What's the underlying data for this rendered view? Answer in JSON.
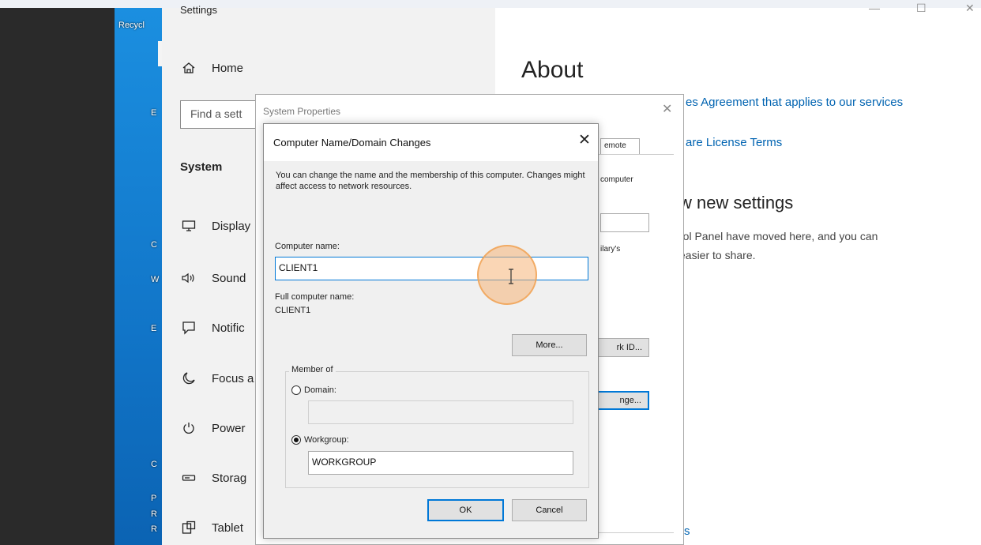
{
  "desktop": {
    "recycle_label": "Recycl",
    "letters": [
      "E",
      "C",
      "W",
      "E",
      "C",
      "P",
      "R",
      "R"
    ]
  },
  "settings": {
    "title": "Settings",
    "window_controls": [
      "—",
      "☐",
      "✕"
    ],
    "home_label": "Home",
    "search_placeholder": "Find a sett",
    "section_heading": "System",
    "nav_items": [
      {
        "label": "Display",
        "icon": "monitor-icon"
      },
      {
        "label": "Sound",
        "icon": "speaker-icon"
      },
      {
        "label": "Notific",
        "icon": "notification-icon"
      },
      {
        "label": "Focus a",
        "icon": "moon-icon"
      },
      {
        "label": "Power",
        "icon": "power-icon"
      },
      {
        "label": "Storag",
        "icon": "storage-icon"
      },
      {
        "label": "Tablet",
        "icon": "tablet-icon"
      }
    ],
    "about_heading": "About",
    "link1": "es Agreement that applies to our services",
    "link2": "are License Terms",
    "related_heading": "w new settings",
    "related_text1": "rol Panel have moved here, and you can",
    "related_text2": "easier to share.",
    "bottom_link": "s"
  },
  "system_properties": {
    "title": "System Properties",
    "close": "✕",
    "tab_label": "emote",
    "text_computer": "computer",
    "text_wizard": "ilary's",
    "network_id_btn": "rk ID...",
    "change_btn": "nge..."
  },
  "cn_dialog": {
    "title": "Computer Name/Domain Changes",
    "close": "✕",
    "description": "You can change the name and the membership of this computer. Changes might affect access to network resources.",
    "computer_name_label": "Computer name:",
    "computer_name_value": "CLIENT1",
    "full_name_label": "Full computer name:",
    "full_name_value": "CLIENT1",
    "more_btn": "More...",
    "member_of_label": "Member of",
    "domain_label": "Domain:",
    "domain_value": "",
    "workgroup_label": "Workgroup:",
    "workgroup_value": "WORKGROUP",
    "selected_membership": "workgroup",
    "ok_btn": "OK",
    "cancel_btn": "Cancel"
  }
}
